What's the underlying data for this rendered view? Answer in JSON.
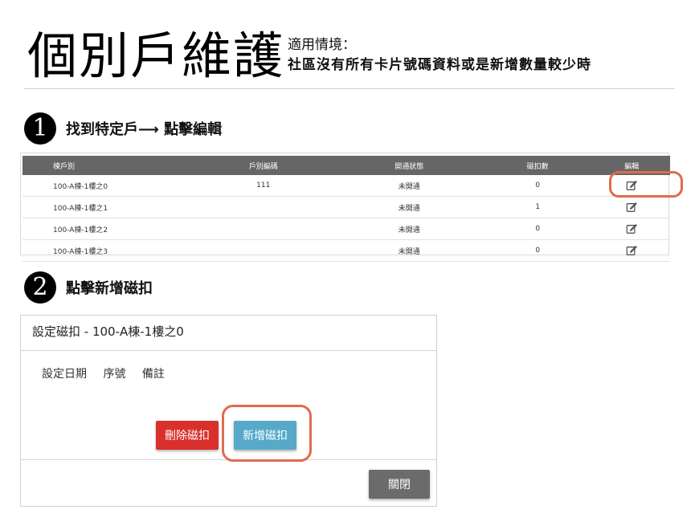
{
  "title": "個別戶維護",
  "subtitle": {
    "line1": "適用情境：",
    "line2": "社區沒有所有卡片號碼資料或是新增數量較少時"
  },
  "step1": {
    "number": "1",
    "text": "找到特定戶⟶ 點擊編輯"
  },
  "step2": {
    "number": "2",
    "text": "點擊新增磁扣"
  },
  "table": {
    "headers": [
      "棟戶別",
      "戶別編碼",
      "開通狀態",
      "磁扣數",
      "編輯"
    ],
    "rows": [
      [
        "100-A棟-1樓之0",
        "111",
        "未開通",
        "0"
      ],
      [
        "100-A棟-1樓之1",
        "",
        "未開通",
        "1"
      ],
      [
        "100-A棟-1樓之2",
        "",
        "未開通",
        "0"
      ],
      [
        "100-A棟-1樓之3",
        "",
        "未開通",
        "0"
      ]
    ],
    "edit_icon": "edit-icon"
  },
  "modal": {
    "title": "設定磁扣 - 100-A棟-1樓之0",
    "columns": [
      "設定日期",
      "序號",
      "備註"
    ],
    "delete_label": "刪除磁扣",
    "add_label": "新增磁扣",
    "close_label": "關閉"
  },
  "colors": {
    "highlight": "#e06b4f",
    "table_header": "#666666",
    "delete": "#d9302c",
    "add": "#56a9c8",
    "close": "#6b6b6b"
  }
}
